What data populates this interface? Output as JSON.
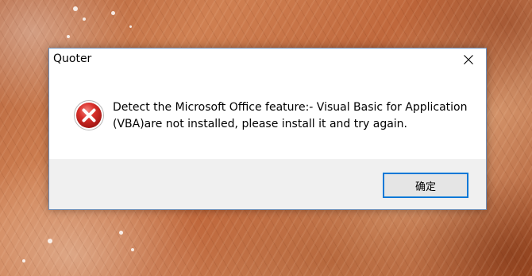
{
  "dialog": {
    "title": "Quoter",
    "close_icon": "close-icon",
    "status_icon": "error-icon",
    "message_line1": "Detect the Microsoft Office feature:- Visual Basic for Application",
    "message_line2": "(VBA)are not installed, please install it and try again.",
    "ok_label": "确定"
  },
  "colors": {
    "dialog_border": "#6f8fb8",
    "button_bar": "#f0f0f0",
    "button_focus_border": "#0078d7",
    "error_red": "#d9302b"
  }
}
